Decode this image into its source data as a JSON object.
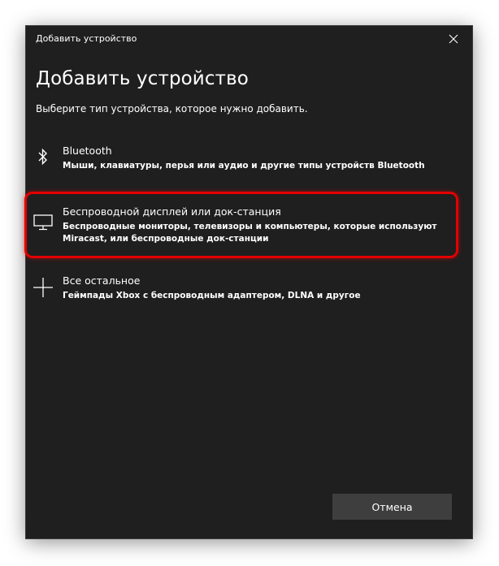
{
  "window": {
    "title": "Добавить устройство"
  },
  "dialog": {
    "heading": "Добавить устройство",
    "subtitle": "Выберите тип устройства, которое нужно добавить."
  },
  "options": [
    {
      "icon": "bluetooth-icon",
      "name": "Bluetooth",
      "description": "Мыши, клавиатуры, перья или аудио и другие типы устройств Bluetooth"
    },
    {
      "icon": "monitor-icon",
      "name": "Беспроводной дисплей или док-станция",
      "description": "Беспроводные мониторы, телевизоры и компьютеры, которые используют Miracast, или беспроводные док-станции",
      "highlighted": true
    },
    {
      "icon": "plus-icon",
      "name": "Все остальное",
      "description": "Геймпады Xbox с беспроводным адаптером, DLNA и другое"
    }
  ],
  "buttons": {
    "cancel_label": "Отмена"
  },
  "colors": {
    "window_bg": "#1f1f1f",
    "text": "#ffffff",
    "button_bg": "#3e3e3e",
    "highlight": "#e30000"
  }
}
